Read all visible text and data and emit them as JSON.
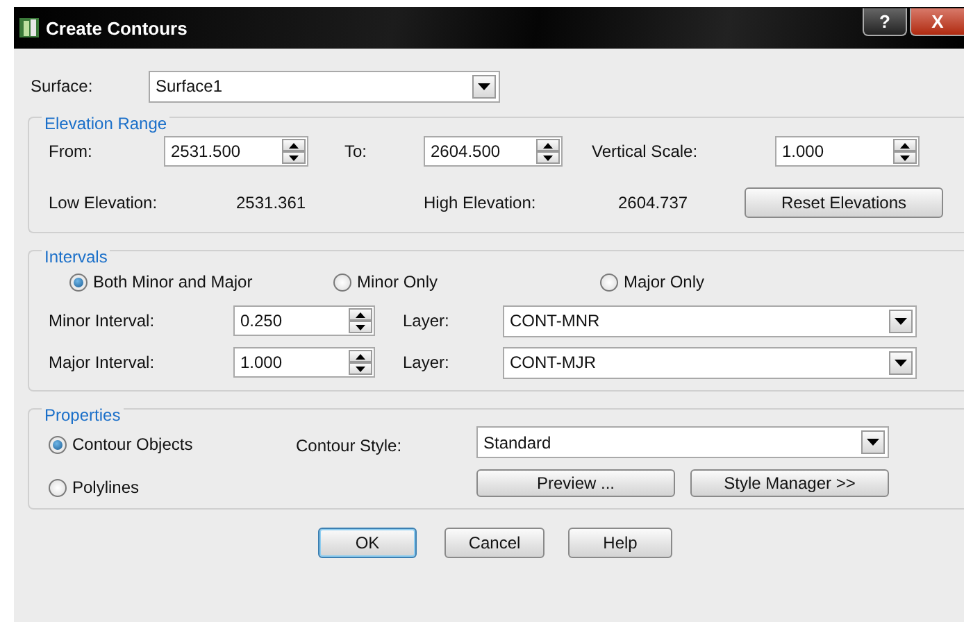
{
  "window": {
    "title": "Create Contours",
    "buttons": [
      "?",
      "X"
    ]
  },
  "surface": {
    "label": "Surface:",
    "value": "Surface1"
  },
  "elevation_range": {
    "title": "Elevation Range",
    "from": {
      "label": "From:",
      "value": "2531.500"
    },
    "to": {
      "label": "To:",
      "value": "2604.500"
    },
    "vertical_scale": {
      "label": "Vertical Scale:",
      "value": "1.000"
    },
    "low_elevation": {
      "label": "Low Elevation:",
      "value": "2531.361"
    },
    "high_elevation": {
      "label": "High Elevation:",
      "value": "2604.737"
    },
    "reset_button": "Reset Elevations"
  },
  "intervals": {
    "title": "Intervals",
    "modes": [
      {
        "label": "Both Minor and Major",
        "selected": true
      },
      {
        "label": "Minor Only",
        "selected": false
      },
      {
        "label": "Major Only",
        "selected": false
      }
    ],
    "minor": {
      "label": "Minor Interval:",
      "value": "0.250",
      "layer_label": "Layer:",
      "layer": "CONT-MNR"
    },
    "major": {
      "label": "Major Interval:",
      "value": "1.000",
      "layer_label": "Layer:",
      "layer": "CONT-MJR"
    }
  },
  "properties": {
    "title": "Properties",
    "output": [
      {
        "label": "Contour Objects",
        "selected": true
      },
      {
        "label": "Polylines",
        "selected": false
      }
    ],
    "style_label": "Contour Style:",
    "style": "Standard",
    "buttons": [
      "Preview ...",
      "Style Manager >>"
    ]
  },
  "buttons": [
    {
      "label": "OK",
      "default": true
    },
    {
      "label": "Cancel",
      "default": false
    },
    {
      "label": "Help",
      "default": false
    }
  ]
}
